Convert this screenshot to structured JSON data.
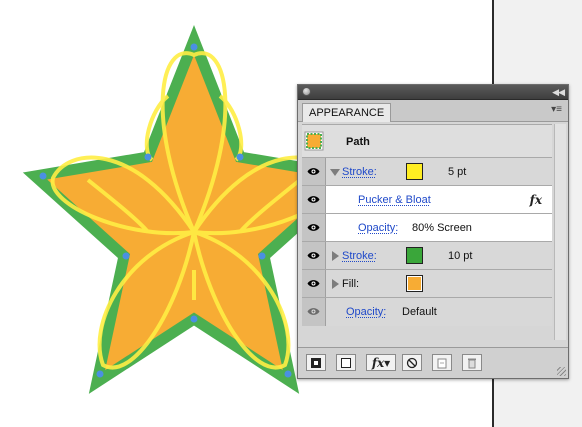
{
  "panel": {
    "tab_label": "APPEARANCE",
    "object_label": "Path",
    "rows": [
      {
        "name": "Stroke:",
        "color": "#ffee22",
        "value": "5 pt",
        "expanded": true
      },
      {
        "effect": "Pucker & Bloat",
        "icon": "fx-icon"
      },
      {
        "name": "Opacity:",
        "value": "80% Screen"
      },
      {
        "name": "Stroke:",
        "color": "#3aa63a",
        "value": "10 pt",
        "expanded": false
      },
      {
        "name": "Fill:",
        "color": "#f7ac34",
        "expanded": false
      },
      {
        "name": "Opacity:",
        "value": "Default"
      }
    ],
    "bottom_buttons": [
      "new-stroke-icon",
      "new-fill-icon",
      "fx-menu-icon",
      "clear-appearance-icon",
      "duplicate-item-icon",
      "delete-item-icon"
    ]
  },
  "colors": {
    "star_fill": "#f7ac34",
    "star_stroke": "#4caf50",
    "bloat_stroke": "#ffee44",
    "anchor_point": "#4a90e2",
    "link": "#1f49c9"
  }
}
